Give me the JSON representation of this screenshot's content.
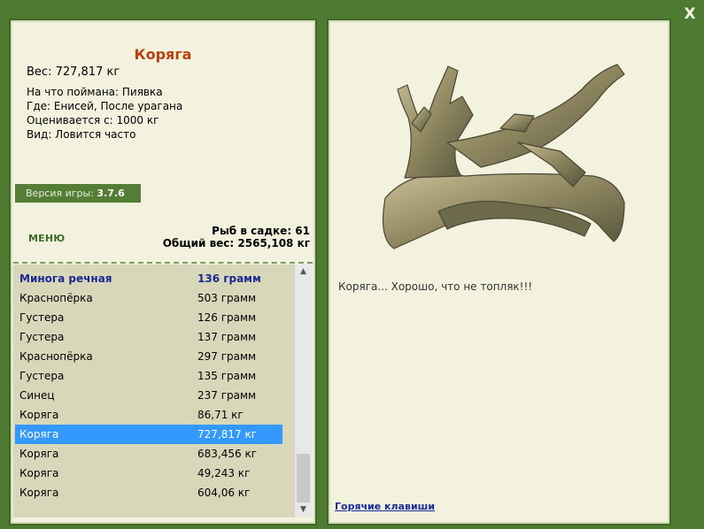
{
  "window": {
    "close_label": "X"
  },
  "fish": {
    "title": "Коряга",
    "weight": "Вес: 727,817 кг",
    "caught_on": "На что поймана: Пиявка",
    "location": "Где: Енисей, После урагана",
    "value": "Оценивается с: 1000 кг",
    "kind": "Вид: Ловится часто"
  },
  "version": {
    "label": "Версия игры:",
    "value": "3.7.6"
  },
  "menu": {
    "label": "МЕНЮ"
  },
  "stats": {
    "in_cage": "Рыб в садке: 61",
    "total_weight": "Общий вес: 2565,108 кг"
  },
  "catch_list": [
    {
      "name": "Минога речная",
      "weight": "136 грамм"
    },
    {
      "name": "Краснопёрка",
      "weight": "503 грамм"
    },
    {
      "name": "Густера",
      "weight": "126 грамм"
    },
    {
      "name": "Густера",
      "weight": "137 грамм"
    },
    {
      "name": "Краснопёрка",
      "weight": "297 грамм"
    },
    {
      "name": "Густера",
      "weight": "135 грамм"
    },
    {
      "name": "Синец",
      "weight": "237 грамм"
    },
    {
      "name": "Коряга",
      "weight": "86,71 кг"
    },
    {
      "name": "Коряга",
      "weight": "727,817 кг"
    },
    {
      "name": "Коряга",
      "weight": "683,456 кг"
    },
    {
      "name": "Коряга",
      "weight": "49,243 кг"
    },
    {
      "name": "Коряга",
      "weight": "604,06 кг"
    }
  ],
  "selected_index": 8,
  "caption": "Коряга... Хорошо, что не топляк!!!",
  "hotkeys": {
    "label": "Горячие клавиши"
  },
  "icons": {
    "close": "close-icon",
    "scroll_up": "arrow-up-icon",
    "scroll_down": "arrow-down-icon"
  },
  "colors": {
    "background": "#4f7a32",
    "panel": "#f3f2df",
    "title": "#b8400e",
    "list_bg": "#d9d7ba",
    "list_header": "#1a2890",
    "selected": "#3399ff",
    "version_bar": "#547d36",
    "link": "#1a2a9a"
  }
}
